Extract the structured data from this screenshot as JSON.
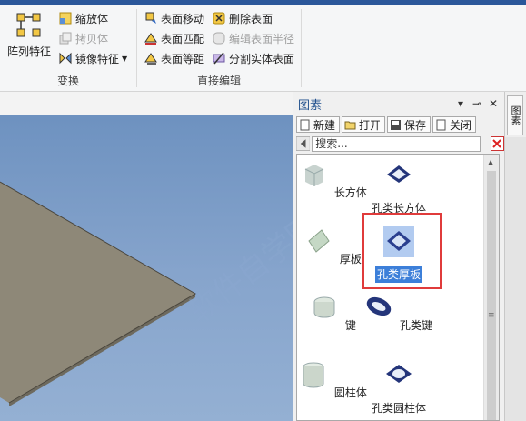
{
  "ribbon": {
    "array_feature": "阵列特征",
    "scale_body": "缩放体",
    "copy_body": "拷贝体",
    "mirror_feature": "镜像特征",
    "transform_group": "变换",
    "move_face": "表面移动",
    "delete_face": "删除表面",
    "match_face": "表面匹配",
    "edit_face_radius": "编辑表面半径",
    "offset_face": "表面等距",
    "split_solid_face": "分割实体表面",
    "direct_edit_group": "直接编辑"
  },
  "panel": {
    "title": "图素",
    "new": "新建",
    "open": "打开",
    "save": "保存",
    "close": "关闭",
    "search_placeholder": "搜索...",
    "side_tab": "图素"
  },
  "items": [
    {
      "label": "长方体",
      "icon": "box-icon"
    },
    {
      "label": "孔类长方体",
      "icon": "box-hole-icon"
    },
    {
      "label": "厚板",
      "icon": "thick-plate-icon"
    },
    {
      "label": "孔类厚板",
      "icon": "plate-hole-icon",
      "selected": true
    },
    {
      "label": "键",
      "icon": "key-icon"
    },
    {
      "label": "孔类键",
      "icon": "key-hole-icon"
    },
    {
      "label": "圆柱体",
      "icon": "cylinder-icon"
    },
    {
      "label": "孔类圆柱体",
      "icon": "cylinder-hole-icon"
    }
  ],
  "colors": {
    "accent": "#2b579a",
    "selection_frame": "#e03b3b",
    "selected_label": "#3c7fd9"
  }
}
